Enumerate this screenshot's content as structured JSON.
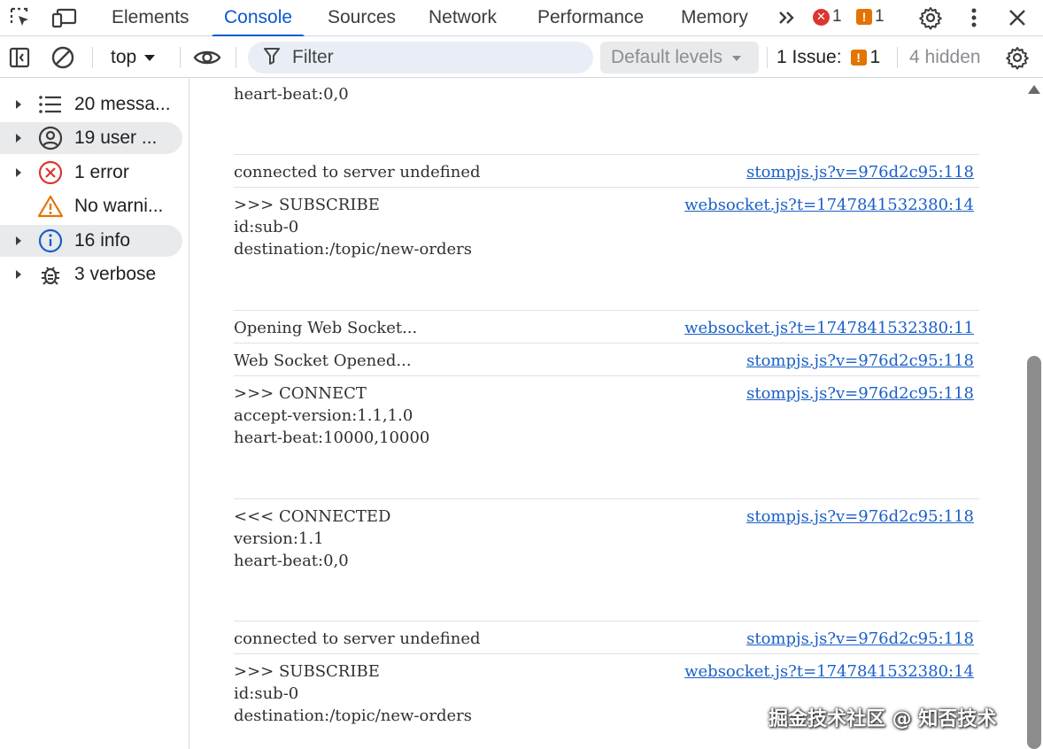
{
  "tabs": [
    {
      "label": "Elements"
    },
    {
      "label": "Console"
    },
    {
      "label": "Sources"
    },
    {
      "label": "Network"
    },
    {
      "label": "Performance"
    },
    {
      "label": "Memory"
    }
  ],
  "tabbar": {
    "more_icon": "chevrons-right-icon",
    "error_count": "1",
    "warning_count": "1"
  },
  "toolbar": {
    "context": "top",
    "filter_placeholder": "Filter",
    "levels": "Default levels",
    "issues_label": "1 Issue:",
    "issues_count": "1",
    "hidden": "4 hidden"
  },
  "sidebar": {
    "items": [
      {
        "label": "20 messa...",
        "icon": "list-icon"
      },
      {
        "label": "19 user ...",
        "icon": "user-icon"
      },
      {
        "label": "1 error",
        "icon": "error-icon"
      },
      {
        "label": "No warni...",
        "icon": "warning-icon"
      },
      {
        "label": "16 info",
        "icon": "info-icon"
      },
      {
        "label": "3 verbose",
        "icon": "bug-icon"
      }
    ]
  },
  "log": {
    "entries": [
      {
        "lines": [
          "heart-beat:0,0"
        ],
        "source": ""
      },
      {
        "lines": [
          "connected to server undefined"
        ],
        "source": "stompjs.js?v=976d2c95:118"
      },
      {
        "lines": [
          ">>> SUBSCRIBE",
          "id:sub-0",
          "destination:/topic/new-orders"
        ],
        "source": "websocket.js?t=1747841532380:14"
      },
      {
        "lines": [
          "Opening Web Socket..."
        ],
        "source": "websocket.js?t=1747841532380:11"
      },
      {
        "lines": [
          "Web Socket Opened..."
        ],
        "source": "stompjs.js?v=976d2c95:118"
      },
      {
        "lines": [
          ">>> CONNECT",
          "accept-version:1.1,1.0",
          "heart-beat:10000,10000"
        ],
        "source": "stompjs.js?v=976d2c95:118"
      },
      {
        "lines": [
          "<<< CONNECTED",
          "version:1.1",
          "heart-beat:0,0"
        ],
        "source": "stompjs.js?v=976d2c95:118"
      },
      {
        "lines": [
          "connected to server undefined"
        ],
        "source": "stompjs.js?v=976d2c95:118"
      },
      {
        "lines": [
          ">>> SUBSCRIBE",
          "id:sub-0",
          "destination:/topic/new-orders"
        ],
        "source": "websocket.js?t=1747841532380:14"
      }
    ]
  },
  "watermark": "掘金技术社区 @ 知否技术",
  "colors": {
    "accent": "#0b57d0",
    "link": "#1a5fc6",
    "error": "#dc362e",
    "warning": "#e37400"
  }
}
